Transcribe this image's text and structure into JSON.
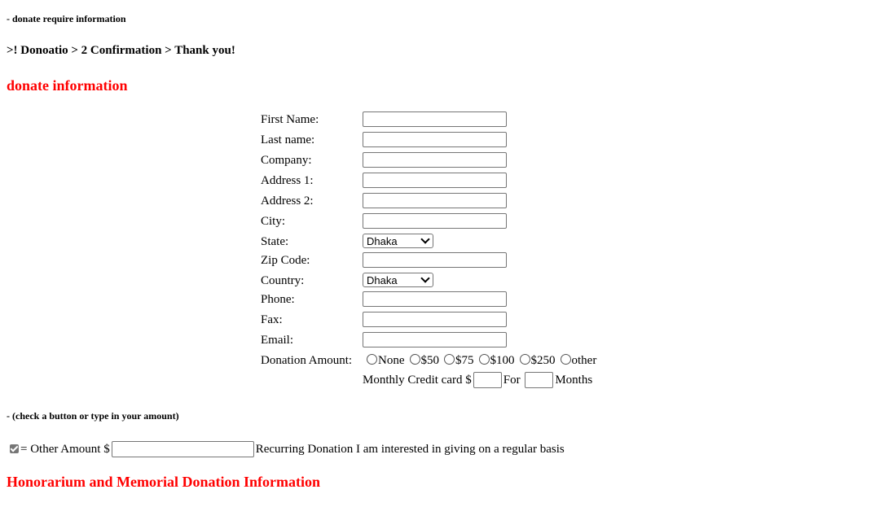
{
  "notes": {
    "top": "- donate require information",
    "mid": "- (check a button or type in your amount)"
  },
  "breadcrumb": ">! Donoatio > 2 Confirmation > Thank you!",
  "sections": {
    "donate_title": "donate information",
    "honor_title": "Honorarium and Memorial Donation Information"
  },
  "form": {
    "first_name": {
      "label": "First Name:",
      "value": ""
    },
    "last_name": {
      "label": "Last name:",
      "value": ""
    },
    "company": {
      "label": "Company:",
      "value": ""
    },
    "address1": {
      "label": "Address 1:",
      "value": ""
    },
    "address2": {
      "label": "Address 2:",
      "value": ""
    },
    "city": {
      "label": "City:",
      "value": ""
    },
    "state": {
      "label": "State:",
      "selected": "Dhaka"
    },
    "zip": {
      "label": "Zip Code:",
      "value": ""
    },
    "country": {
      "label": "Country:",
      "selected": "Dhaka"
    },
    "phone": {
      "label": "Phone:",
      "value": ""
    },
    "fax": {
      "label": "Fax:",
      "value": ""
    },
    "email": {
      "label": "Email:",
      "value": ""
    },
    "donation": {
      "label": "Donation Amount:",
      "options": [
        "None",
        "$50",
        "$75",
        "$100",
        "$250",
        "other"
      ]
    },
    "monthly": {
      "prefix": "Monthly Credit card $",
      "for": "For",
      "months": "Months"
    }
  },
  "other_amount": {
    "checked": true,
    "label": "= Other Amount $",
    "value": "",
    "recurring": "Recurring Donation I am interested in giving on a regular basis"
  }
}
